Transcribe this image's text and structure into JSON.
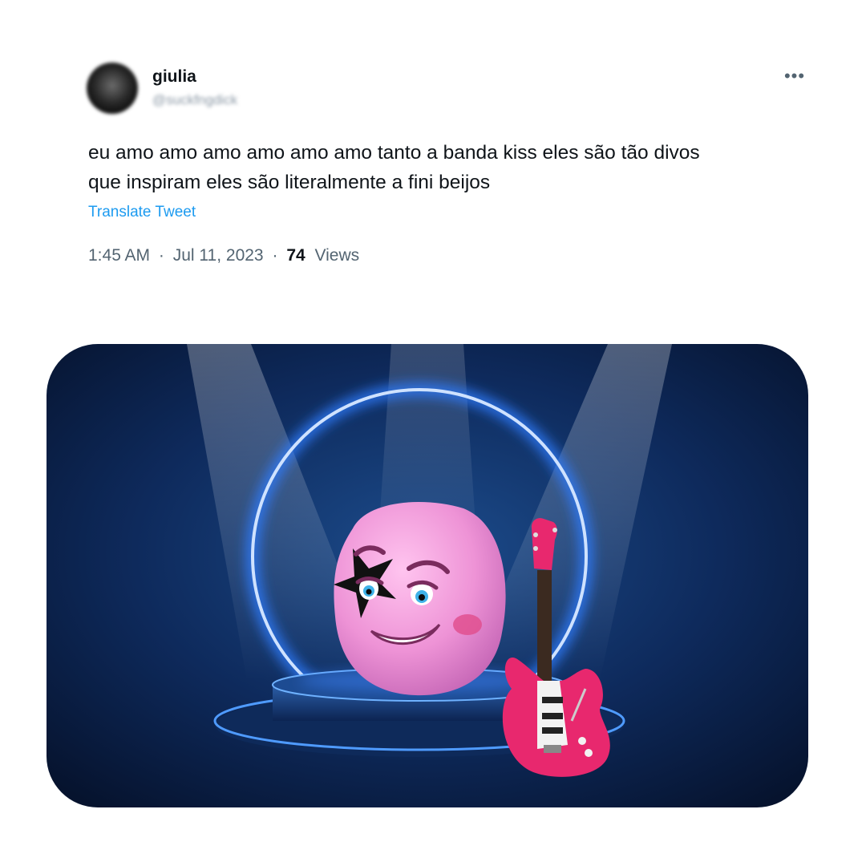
{
  "tweet": {
    "author_name": "giulia",
    "author_handle": "@suckfngdick",
    "more_icon": "•••",
    "text_lines": [
      "eu amo amo amo amo amo amo tanto a banda kiss eles são tão divos",
      "que inspiram eles são literalmente a fini beijos"
    ],
    "translate_label": "Translate Tweet",
    "time": "1:45 AM",
    "date": "Jul 11, 2023",
    "separator": "·",
    "views_count": "74",
    "views_label": "Views"
  },
  "media": {
    "description_icon": "stage-character-guitar-illustration",
    "colors": {
      "stage_bg": "#0b1f4a",
      "ring": "#6fa8ff",
      "character": "#f2a0dc",
      "guitar": "#e8286e"
    }
  }
}
